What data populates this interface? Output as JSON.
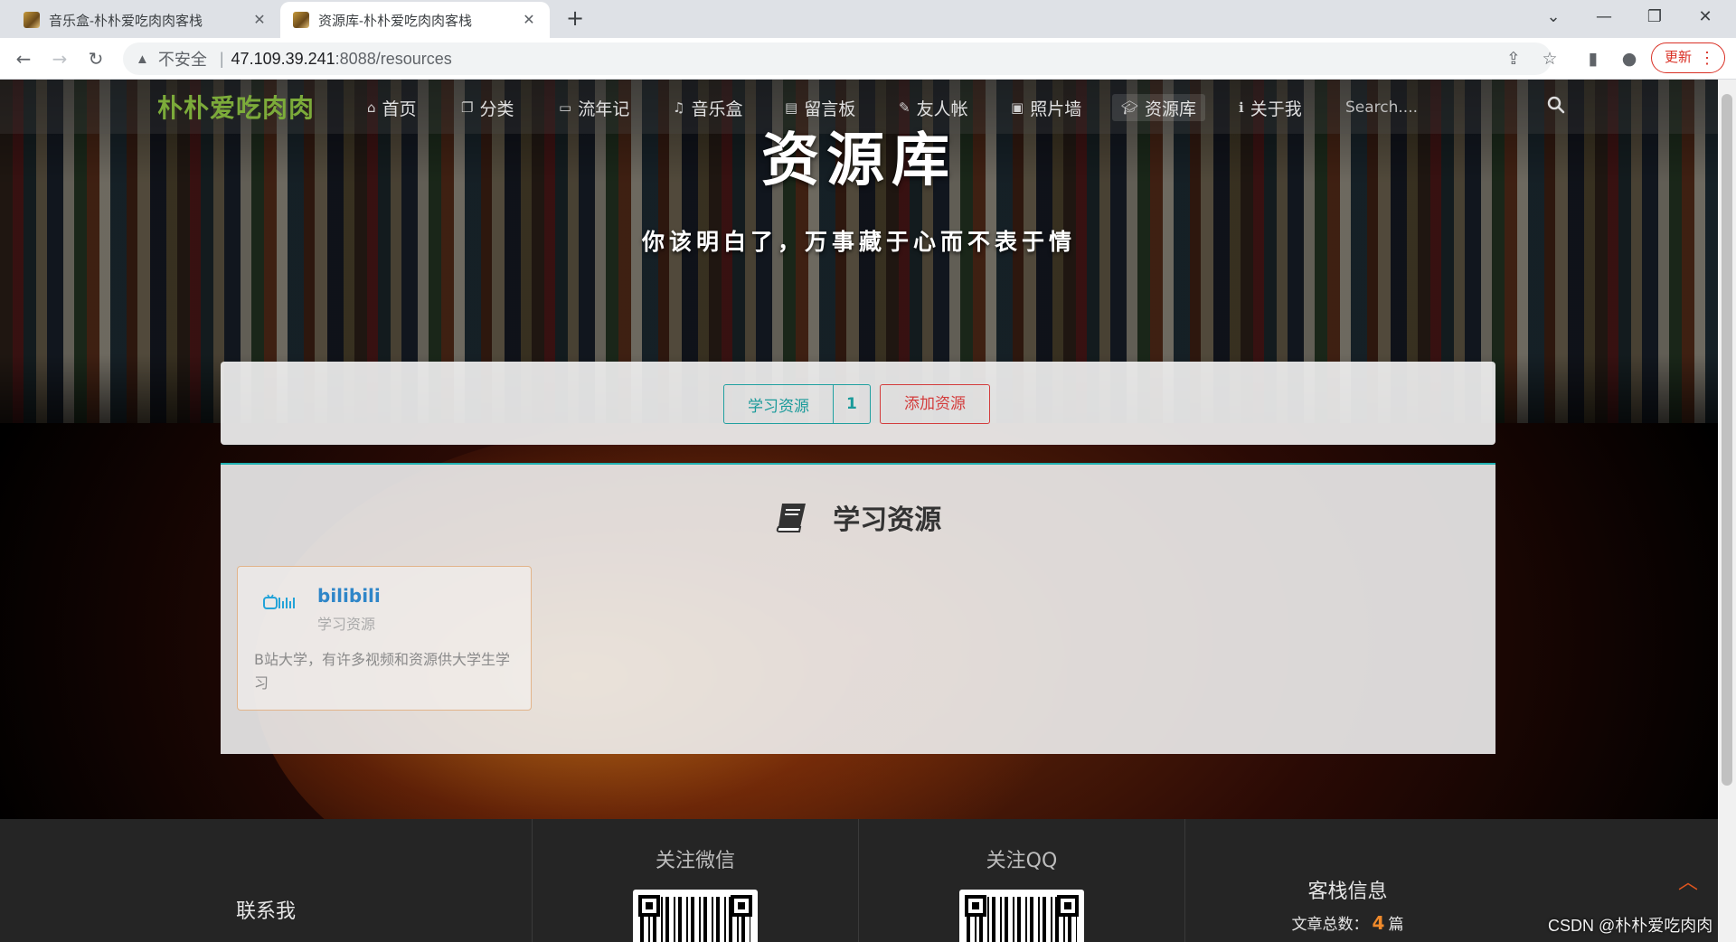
{
  "browser": {
    "tabs": [
      {
        "title": "音乐盒-朴朴爱吃肉肉客栈"
      },
      {
        "title": "资源库-朴朴爱吃肉肉客栈"
      }
    ],
    "insecure_label": "不安全",
    "url_host": "47.109.39.241",
    "url_rest": ":8088/resources",
    "update_label": "更新"
  },
  "site": {
    "brand": "朴朴爱吃肉肉",
    "nav": [
      {
        "label": "首页",
        "icon": "home-icon"
      },
      {
        "label": "分类",
        "icon": "copy-icon"
      },
      {
        "label": "流年记",
        "icon": "monitor-icon"
      },
      {
        "label": "音乐盒",
        "icon": "music-icon"
      },
      {
        "label": "留言板",
        "icon": "clipboard-icon"
      },
      {
        "label": "友人帐",
        "icon": "pencil-icon"
      },
      {
        "label": "照片墙",
        "icon": "image-icon"
      },
      {
        "label": "资源库",
        "icon": "graduation-cap-icon"
      },
      {
        "label": "关于我",
        "icon": "info-icon"
      }
    ],
    "search_placeholder": "Search...."
  },
  "hero": {
    "title": "资源库",
    "subtitle": "你该明白了，万事藏于心而不表于情"
  },
  "resource_tabs": {
    "tab_label": "学习资源",
    "tab_count": "1",
    "add_label": "添加资源"
  },
  "section": {
    "title": "学习资源",
    "cards": [
      {
        "name": "bilibili",
        "category": "学习资源",
        "description": "B站大学，有许多视频和资源供大学生学习"
      }
    ]
  },
  "footer": {
    "contact": "联系我",
    "wechat": "关注微信",
    "qq": "关注QQ",
    "info": "客栈信息",
    "article_label": "文章总数：",
    "article_count": "4",
    "article_unit": "篇"
  },
  "watermark": "CSDN @朴朴爱吃肉肉"
}
